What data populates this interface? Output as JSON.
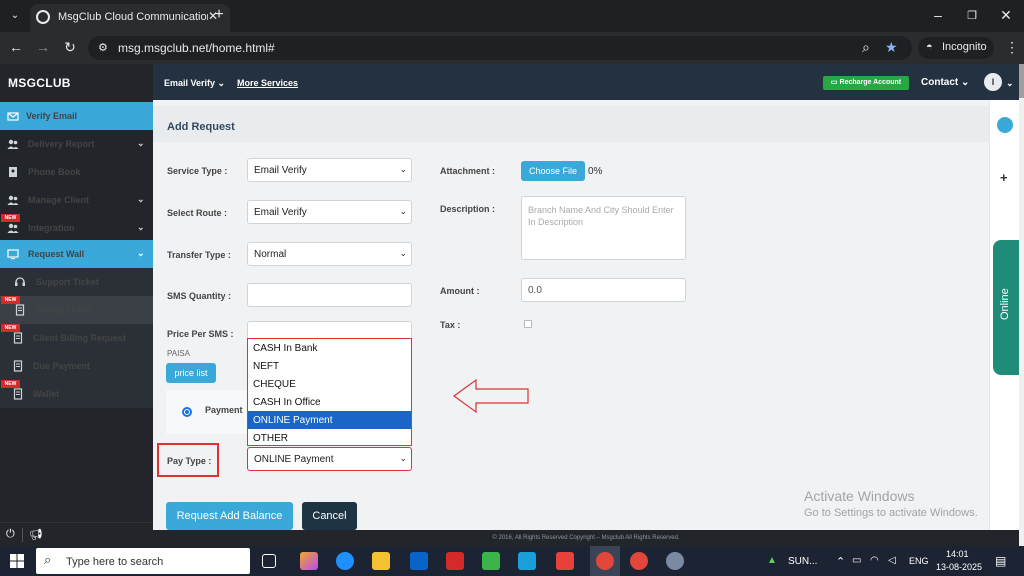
{
  "browser": {
    "tab_title": "MsgClub Cloud Communication",
    "url": "msg.msgclub.net/home.html#",
    "incognito_label": "Incognito"
  },
  "sidebar": {
    "brand": "MSGCLUB",
    "items": [
      {
        "label": "Verify Email"
      },
      {
        "label": "Delivery Report"
      },
      {
        "label": "Phone Book"
      },
      {
        "label": "Manage Client"
      },
      {
        "label": "Integration",
        "badge": "NEW"
      },
      {
        "label": "Request Wall"
      },
      {
        "label": "Support Ticket"
      },
      {
        "label": "Billing Ticket",
        "badge": "NEW"
      },
      {
        "label": "Client Billing Request",
        "badge": "NEW"
      },
      {
        "label": "Due Payment"
      },
      {
        "label": "Wallet",
        "badge": "NEW"
      }
    ]
  },
  "topnav": {
    "email_verify": "Email Verify",
    "more_services": "More Services",
    "recharge": "Recharge Account",
    "contact": "Contact",
    "avatar": "I"
  },
  "form": {
    "title": "Add Request",
    "service_type_label": "Service Type :",
    "service_type_value": "Email Verify",
    "select_route_label": "Select Route :",
    "select_route_value": "Email Verify",
    "transfer_type_label": "Transfer Type :",
    "transfer_type_value": "Normal",
    "sms_quantity_label": "SMS Quantity :",
    "price_per_sms_label": "Price Per SMS :",
    "paisa": "PAISA",
    "price_list": "price list",
    "payment_label": "Payment",
    "pay_type_label": "Pay Type :",
    "pay_type_value": "ONLINE Payment",
    "pay_type_options": [
      "CASH In Bank",
      "NEFT",
      "CHEQUE",
      "CASH In Office",
      "ONLINE Payment",
      "OTHER"
    ],
    "attachment_label": "Attachment :",
    "choose_file": "Choose File",
    "upload_percent": "0%",
    "description_label": "Description :",
    "description_placeholder": "Branch Name And City Should Enter In Description",
    "amount_label": "Amount :",
    "amount_value": "0.0",
    "tax_label": "Tax :",
    "submit": "Request Add Balance",
    "cancel": "Cancel"
  },
  "online_tab": "Online",
  "footer": "© 2016, All Rights Reserved Copyright – Msgclub All Rights Reserved.",
  "watermark": {
    "title": "Activate Windows",
    "subtitle": "Go to Settings to activate Windows."
  },
  "taskbar": {
    "search_placeholder": "Type here to search",
    "weather": "SUN...",
    "lang": "ENG",
    "time": "14:01",
    "date": "13-08-2025"
  },
  "colors": {
    "accent": "#3aa8d8",
    "sidebar": "#22262b",
    "topnav": "#233140",
    "highlight_box": "#dd3333",
    "selected_option": "#1a65c7"
  }
}
